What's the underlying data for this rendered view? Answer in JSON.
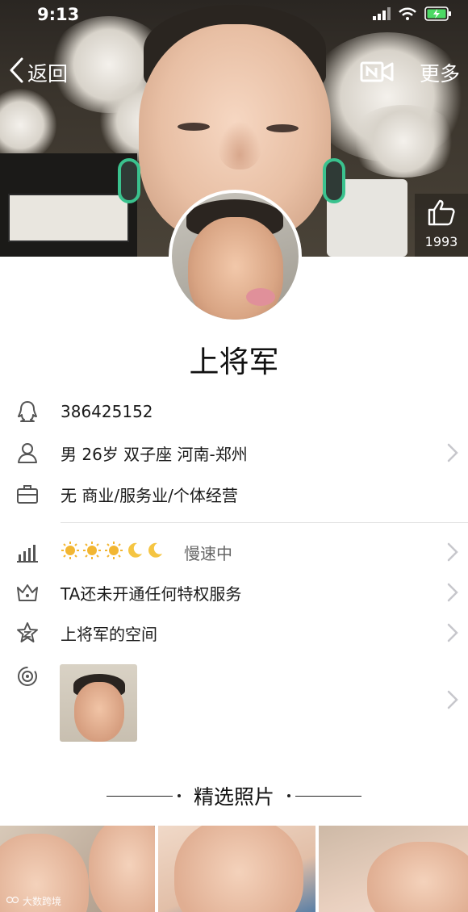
{
  "status_bar": {
    "time": "9:13"
  },
  "nav": {
    "back_label": "返回",
    "more_label": "更多"
  },
  "cover": {
    "like_count": "1993"
  },
  "profile": {
    "name": "上将军",
    "qq_number": "386425152",
    "basic_info": "男 26岁 双子座 河南-郑州",
    "occupation": "无 商业/服务业/个体经营",
    "level_icons": [
      "sun-icon",
      "sun-icon",
      "sun-icon",
      "moon-icon",
      "moon-icon"
    ],
    "level_status": "慢速中",
    "privilege_text": "TA还未开通任何特权服务",
    "space_text": "上将军的空间"
  },
  "featured": {
    "title": "精选照片"
  },
  "watermark": {
    "text": "大数跨境"
  },
  "colors": {
    "chevron": "#c7c7cc",
    "icon_gray": "#555555",
    "sun": "#f2b632",
    "moon": "#f5c542",
    "battery_green": "#4cd964"
  }
}
